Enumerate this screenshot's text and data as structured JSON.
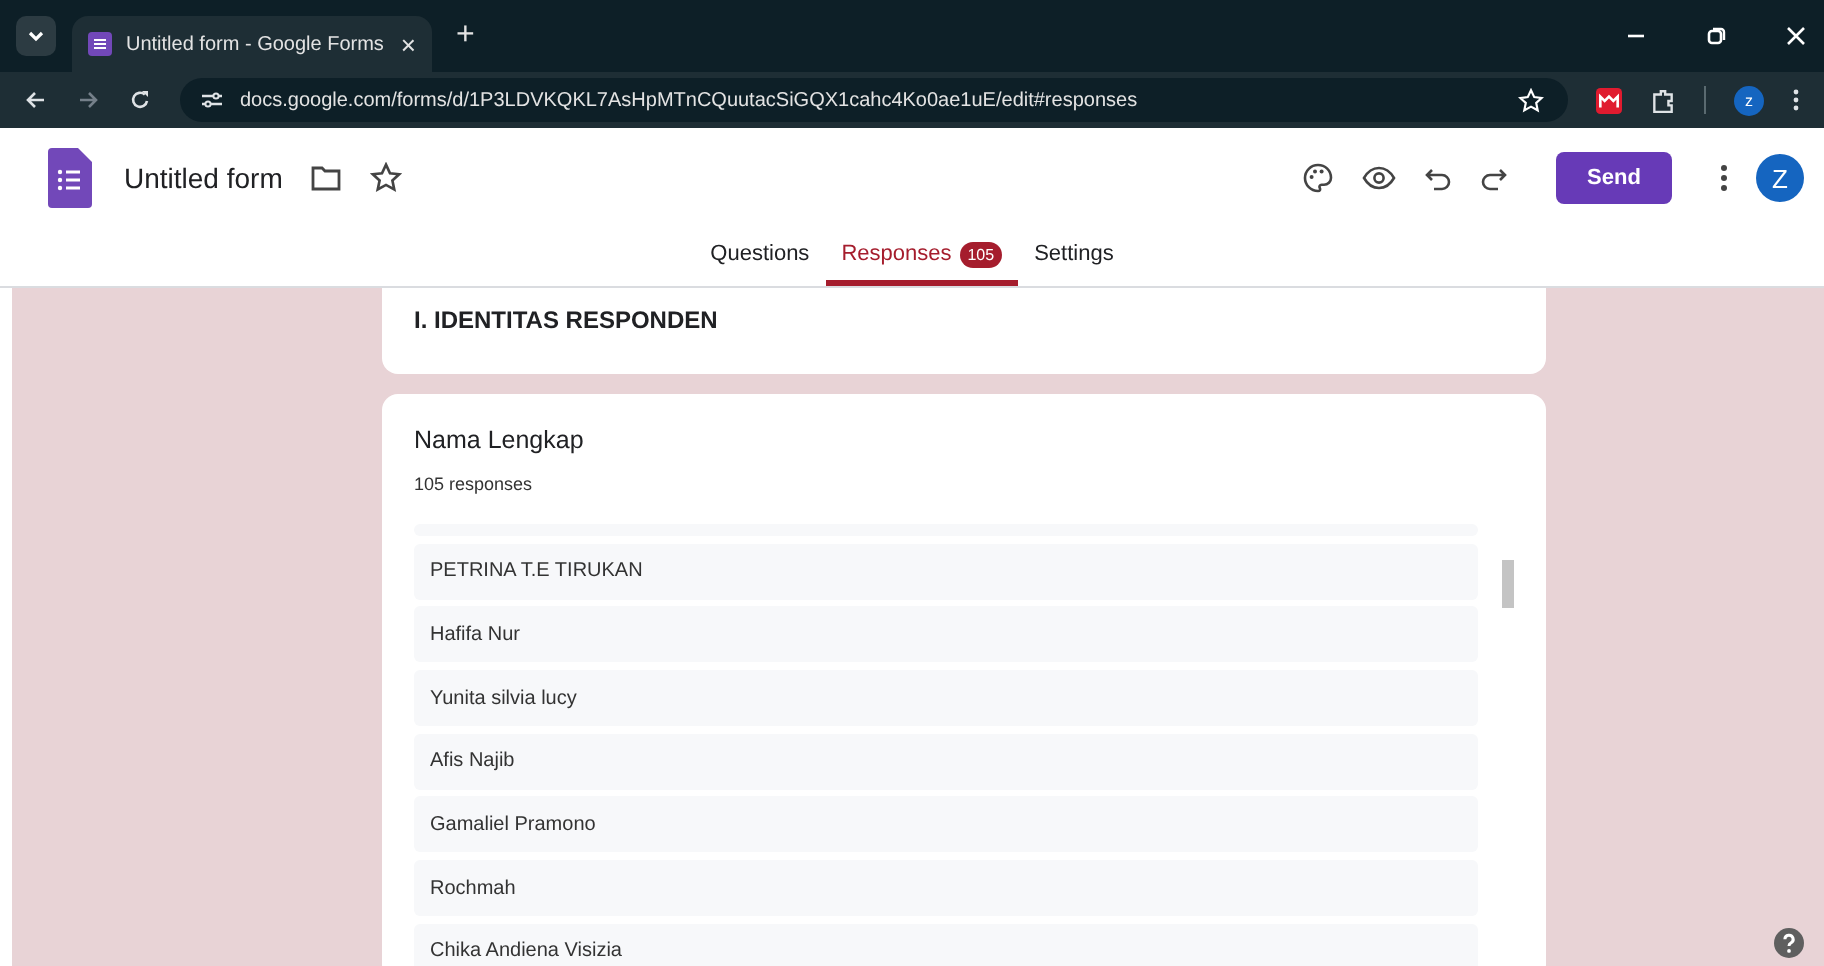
{
  "browser": {
    "tab_title": "Untitled form - Google Forms",
    "tab_close": "×",
    "new_tab": "+",
    "url": "docs.google.com/forms/d/1P3LDVKQKL7AsHpMTnCQuutacSiGQX1cahc4Ko0ae1uE/edit#responses",
    "profile": "z"
  },
  "header": {
    "title": "Untitled form",
    "send": "Send",
    "avatar": "Z"
  },
  "tabs": [
    {
      "label": "Questions",
      "selected": false
    },
    {
      "label": "Responses",
      "selected": true,
      "badge": "105"
    },
    {
      "label": "Settings",
      "selected": false
    }
  ],
  "section": {
    "title": "I. IDENTITAS RESPONDEN"
  },
  "question": {
    "title": "Nama Lengkap",
    "count": "105 responses",
    "responses": [
      "PETRINA T.E TIRUKAN",
      "Hafifa Nur",
      "Yunita silvia lucy",
      "Afis Najib",
      "Gamaliel Pramono",
      "Rochmah",
      "Chika Andiena Visizia"
    ]
  }
}
